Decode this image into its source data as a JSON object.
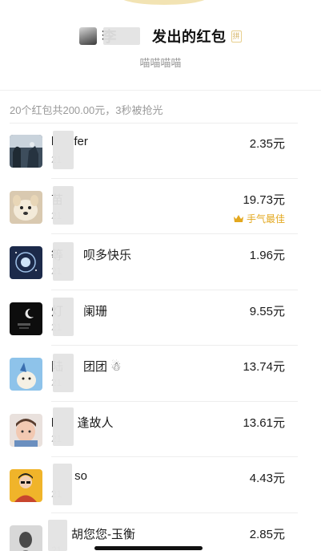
{
  "header": {
    "title": "李        发出的红包",
    "pin_badge": "拼",
    "blessing": "喵喵喵喵"
  },
  "summary": "20个红包共200.00元，3秒被抢光",
  "best_label": "手气最佳",
  "rows": [
    {
      "name": "l      fer",
      "time": "21",
      "amount": "2.35元"
    },
    {
      "name": "苗",
      "time": "21",
      "amount": "19.73元"
    },
    {
      "name": "等      呗多快乐",
      "time": "21",
      "amount": "1.96元"
    },
    {
      "name": "灯      阑珊",
      "time": "21",
      "amount": "9.55元"
    },
    {
      "name": "陆      团团 ☃",
      "time": "21",
      "amount": "13.74元"
    },
    {
      "name": "l       逢故人",
      "time": "21",
      "amount": "13.61元"
    },
    {
      "name": "       so",
      "time": "21",
      "amount": "4.43元"
    },
    {
      "name": "      胡您您-玉衡",
      "time": "21",
      "amount": "2.85元"
    }
  ],
  "colors": {
    "best_gold": "#e3a81f",
    "secondary_text": "#999999"
  }
}
